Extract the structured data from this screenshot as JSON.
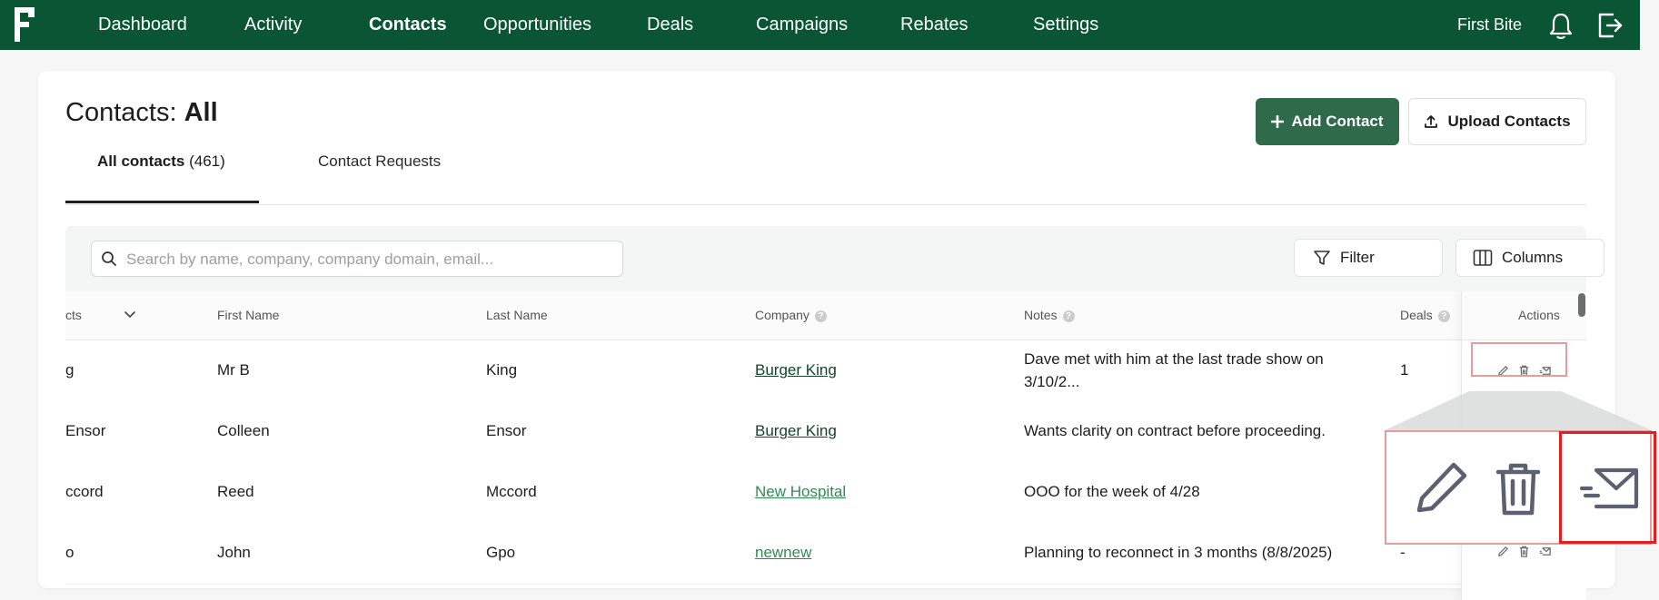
{
  "nav": {
    "items": [
      {
        "label": "Dashboard"
      },
      {
        "label": "Activity"
      },
      {
        "label": "Contacts"
      },
      {
        "label": "Opportunities"
      },
      {
        "label": "Deals"
      },
      {
        "label": "Campaigns"
      },
      {
        "label": "Rebates"
      },
      {
        "label": "Settings"
      }
    ],
    "active": "Contacts",
    "tenant": "First Bite",
    "icons": [
      "bell-icon",
      "logout-icon"
    ]
  },
  "page": {
    "title_prefix": "Contacts: ",
    "title_strong": "All",
    "add_button": "Add Contact",
    "upload_button": "Upload Contacts"
  },
  "tabs": {
    "all_label": "All contacts",
    "all_count": " (461)",
    "requests_label": "Contact Requests"
  },
  "toolbar": {
    "search_placeholder": "Search by name, company, company domain, email...",
    "filter_label": "Filter",
    "columns_label": "Columns"
  },
  "table": {
    "headers": {
      "contacts": "cts",
      "first_name": "First Name",
      "last_name": "Last Name",
      "company": "Company",
      "notes": "Notes",
      "deals": "Deals",
      "actions": "Actions"
    },
    "rows": [
      {
        "contact": "g",
        "first": "Mr B",
        "last": "King",
        "company": "Burger King",
        "company_style": "dark",
        "notes_line1": "Dave met with him at the last trade show on",
        "notes_line2": "3/10/2...",
        "deals": "1"
      },
      {
        "contact": "Ensor",
        "first": "Colleen",
        "last": "Ensor",
        "company": "Burger King",
        "company_style": "dark",
        "notes": "Wants clarity on contract before proceeding.",
        "deals": ""
      },
      {
        "contact": "ccord",
        "first": "Reed",
        "last": "Mccord",
        "company": "New Hospital",
        "company_style": "green",
        "notes": "OOO for the week of 4/28",
        "deals": ""
      },
      {
        "contact": "o",
        "first": "John",
        "last": "Gpo",
        "company": "newnew",
        "company_style": "green",
        "notes": "Planning to reconnect in 3 months (8/8/2025)",
        "deals": "-"
      }
    ]
  },
  "colors": {
    "nav_bg": "#0a5533",
    "primary_button": "#2f6b4a",
    "link_dark": "#14432c",
    "link_green": "#2f8a55",
    "highlight": "#e79b9b",
    "highlight_strong": "#e02020"
  }
}
